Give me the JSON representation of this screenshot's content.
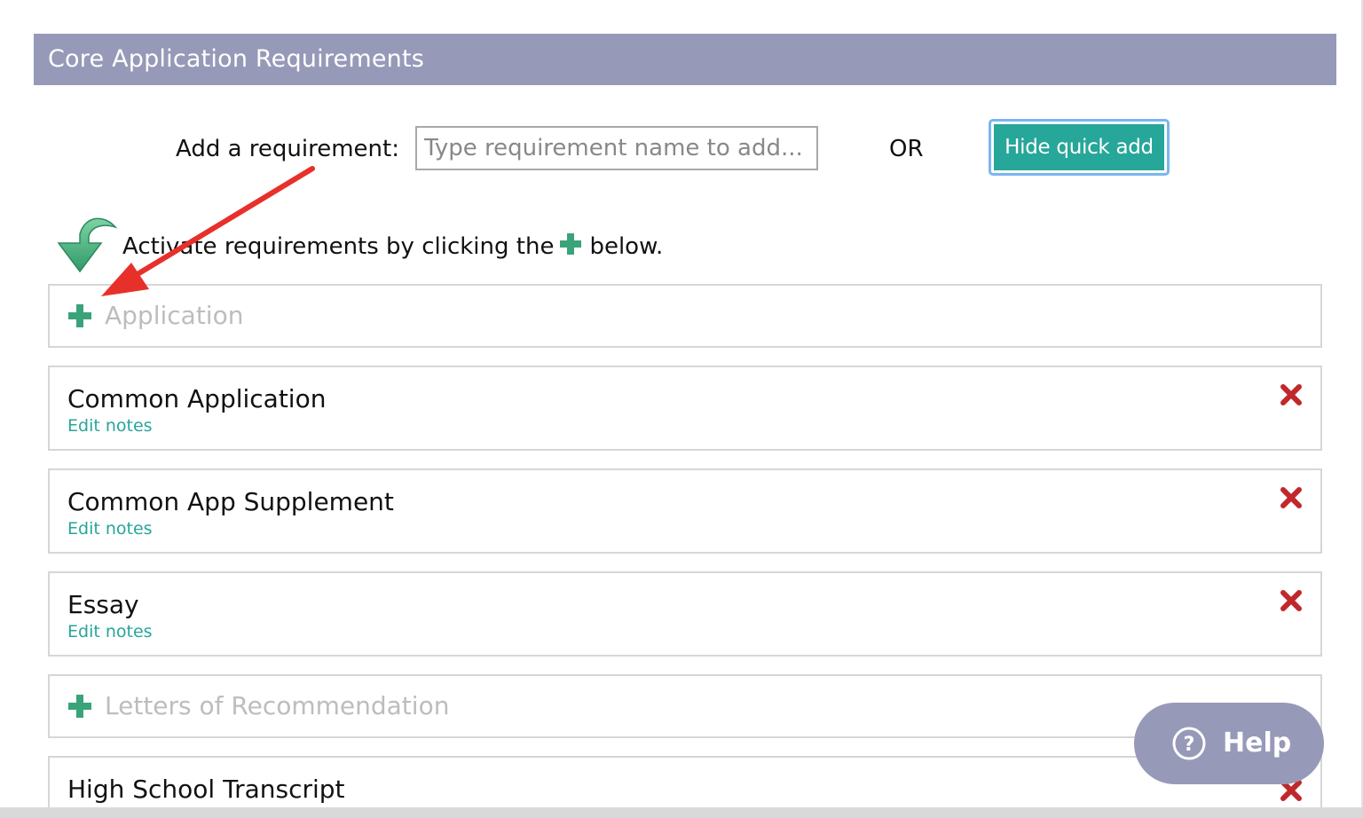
{
  "section": {
    "title": "Core Application Requirements"
  },
  "quick_add": {
    "label": "Add a requirement:",
    "placeholder": "Type requirement name to add...",
    "or_text": "OR",
    "hide_button": "Hide quick add"
  },
  "instruction": {
    "before": "Activate requirements by clicking the",
    "after": "below."
  },
  "requirements": [
    {
      "name": "Application",
      "active": false
    },
    {
      "name": "Common Application",
      "active": true,
      "notes_label": "Edit notes"
    },
    {
      "name": "Common App Supplement",
      "active": true,
      "notes_label": "Edit notes"
    },
    {
      "name": "Essay",
      "active": true,
      "notes_label": "Edit notes"
    },
    {
      "name": "Letters of Recommendation",
      "active": false
    },
    {
      "name": "High School Transcript",
      "active": true
    }
  ],
  "help": {
    "label": "Help",
    "icon": "question-circle-icon"
  },
  "colors": {
    "header_bg": "#9799b8",
    "accent_teal": "#27a69a",
    "remove_red": "#c0282b",
    "annotation_red": "#e8302a"
  }
}
